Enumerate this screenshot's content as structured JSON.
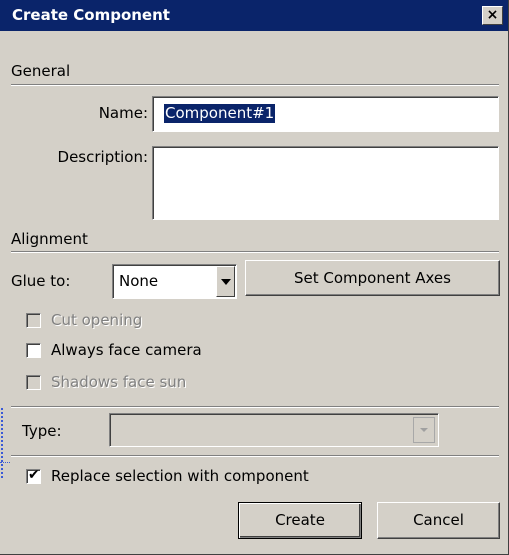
{
  "window": {
    "title": "Create Component",
    "close_glyph": "×"
  },
  "general": {
    "section_label": "General",
    "name_label": "Name:",
    "name_value": "Component#1",
    "description_label": "Description:",
    "description_value": ""
  },
  "alignment": {
    "section_label": "Alignment",
    "glue_to_label": "Glue to:",
    "glue_to_value": "None",
    "set_axes_label": "Set Component Axes",
    "cut_opening_label": "Cut opening",
    "cut_opening_checked": false,
    "cut_opening_enabled": false,
    "always_face_camera_label": "Always face camera",
    "always_face_camera_checked": false,
    "shadows_face_sun_label": "Shadows face sun",
    "shadows_face_sun_checked": false,
    "shadows_face_sun_enabled": false
  },
  "type": {
    "label": "Type:",
    "value": ""
  },
  "replace": {
    "label": "Replace selection with component",
    "checked": true,
    "check_glyph": "✔"
  },
  "buttons": {
    "create_label": "Create",
    "cancel_label": "Cancel"
  },
  "colors": {
    "titlebar": "#0a246a",
    "dialog_bg": "#d4d0c8",
    "selection": "#0a246a"
  }
}
